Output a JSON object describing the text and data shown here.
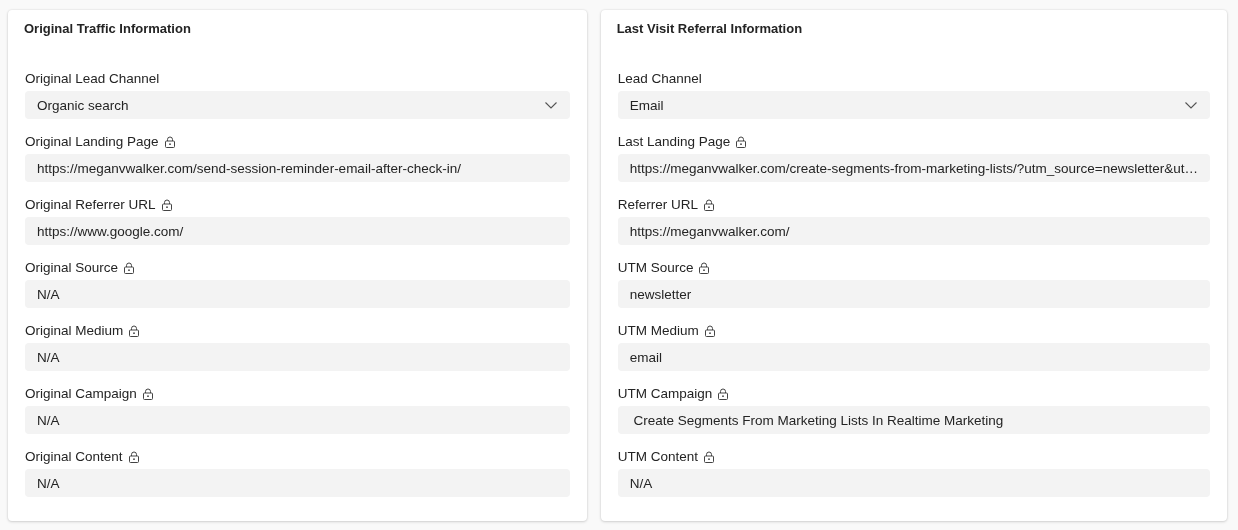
{
  "sections": [
    {
      "title": "Original Traffic Information",
      "fields": [
        {
          "label": "Original Lead Channel",
          "kind": "dropdown",
          "locked": false,
          "value": "Organic search"
        },
        {
          "label": "Original Landing Page",
          "kind": "text",
          "locked": true,
          "value": "https://meganvwalker.com/send-session-reminder-email-after-check-in/"
        },
        {
          "label": "Original Referrer URL",
          "kind": "text",
          "locked": true,
          "value": "https://www.google.com/"
        },
        {
          "label": "Original Source",
          "kind": "text",
          "locked": true,
          "value": "N/A"
        },
        {
          "label": "Original Medium",
          "kind": "text",
          "locked": true,
          "value": "N/A"
        },
        {
          "label": "Original Campaign",
          "kind": "text",
          "locked": true,
          "value": "N/A"
        },
        {
          "label": "Original Content",
          "kind": "text",
          "locked": true,
          "value": "N/A"
        }
      ]
    },
    {
      "title": "Last Visit Referral Information",
      "fields": [
        {
          "label": "Lead Channel",
          "kind": "dropdown",
          "locked": false,
          "value": "Email"
        },
        {
          "label": "Last Landing Page",
          "kind": "text",
          "locked": true,
          "value": "https://meganvwalker.com/create-segments-from-marketing-lists/?utm_source=newsletter&ut…"
        },
        {
          "label": "Referrer URL",
          "kind": "text",
          "locked": true,
          "value": "https://meganvwalker.com/"
        },
        {
          "label": "UTM Source",
          "kind": "text",
          "locked": true,
          "value": "newsletter"
        },
        {
          "label": "UTM Medium",
          "kind": "text",
          "locked": true,
          "value": "email"
        },
        {
          "label": "UTM Campaign",
          "kind": "text",
          "locked": true,
          "value": " Create Segments From Marketing Lists In Realtime Marketing"
        },
        {
          "label": "UTM Content",
          "kind": "text",
          "locked": true,
          "value": "N/A"
        }
      ]
    }
  ]
}
